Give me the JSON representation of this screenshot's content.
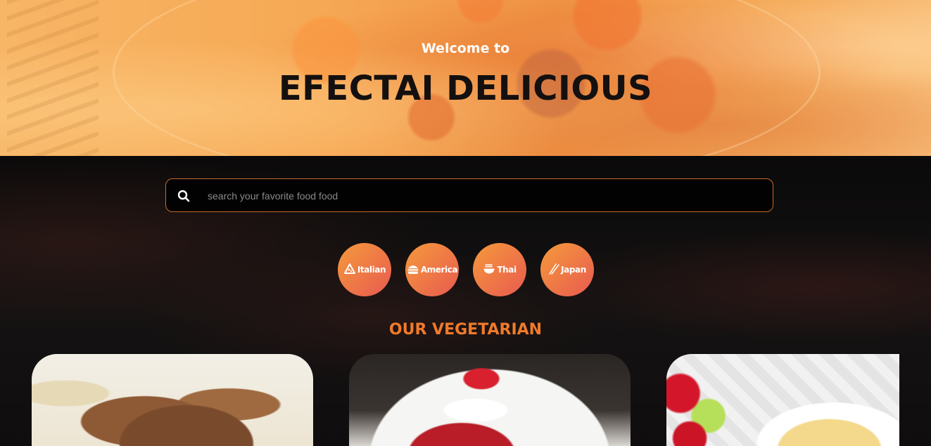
{
  "hero": {
    "welcome": "Welcome to",
    "title": "EFECTAI DELICIOUS"
  },
  "search": {
    "icon": "search-icon",
    "placeholder": "search your favorite food food",
    "value": ""
  },
  "categories": [
    {
      "label": "Italian",
      "icon": "pizza-icon"
    },
    {
      "label": "America",
      "icon": "burger-icon"
    },
    {
      "label": "Thai",
      "icon": "noodle-bowl-icon"
    },
    {
      "label": "Japan",
      "icon": "chopsticks-icon"
    }
  ],
  "section": {
    "title": "OUR VEGETARIAN"
  },
  "colors": {
    "accent": "#f07a2a",
    "category_gradient_start": "#f59a3b",
    "category_gradient_end": "#e85a50",
    "search_border": "#c9692c",
    "background": "#0f0e0e"
  }
}
